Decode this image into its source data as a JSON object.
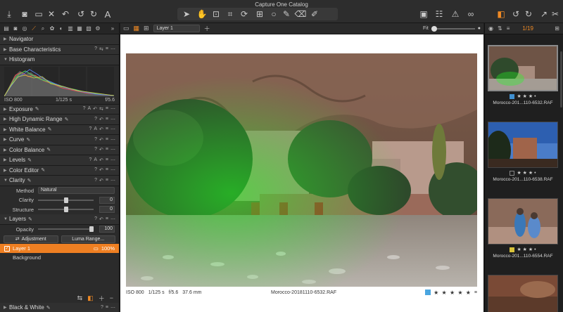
{
  "window": {
    "title": "Capture One Catalog"
  },
  "left_panel": {
    "tools": {
      "navigator": "Navigator",
      "base_characteristics": "Base Characteristics",
      "histogram": "Histogram",
      "exposure": "Exposure",
      "hdr": "High Dynamic Range",
      "white_balance": "White Balance",
      "curve": "Curve",
      "color_balance": "Color Balance",
      "levels": "Levels",
      "color_editor": "Color Editor",
      "clarity": "Clarity",
      "layers": "Layers",
      "black_white": "Black & White"
    },
    "histogram_meta": {
      "iso": "ISO 800",
      "shutter": "1/125 s",
      "aperture": "f/5.6"
    },
    "clarity": {
      "method_label": "Method",
      "method_value": "Natural",
      "clarity_label": "Clarity",
      "clarity_value": "0",
      "structure_label": "Structure",
      "structure_value": "0",
      "clarity_level": 0,
      "structure_level": 0
    },
    "layers": {
      "opacity_label": "Opacity",
      "opacity_value": "100",
      "adjustment_label": "Adjustment",
      "luma_label": "Luma Range...",
      "layer1_name": "Layer 1",
      "layer1_opacity": "100%",
      "background_name": "Background"
    }
  },
  "viewer": {
    "layer_select": "Layer 1",
    "fit_label": "Fit",
    "footer": {
      "iso": "ISO 800",
      "shutter": "1/125 s",
      "aperture": "f/5.6",
      "focal": "37.6 mm",
      "filename": "Morocco-20181110-6532.RAF",
      "stars": "★ ★ ★ ★ ★"
    }
  },
  "browser": {
    "count": "1/19",
    "thumbs": [
      {
        "stars": "★ ★ ★ •",
        "name": "Morocco-201...110-6532.RAF",
        "tag_color": "#3f8fd0"
      },
      {
        "stars": "★ ★ ★ •",
        "name": "Morocco-201...110-6538.RAF",
        "tag_color": ""
      },
      {
        "stars": "★ ★ ★ •",
        "name": "Morocco-201...110-6554.RAF",
        "tag_color": "#d8c23a"
      }
    ]
  },
  "colors": {
    "accent": "#f08a24",
    "selected_layer": "#ee7f22"
  }
}
